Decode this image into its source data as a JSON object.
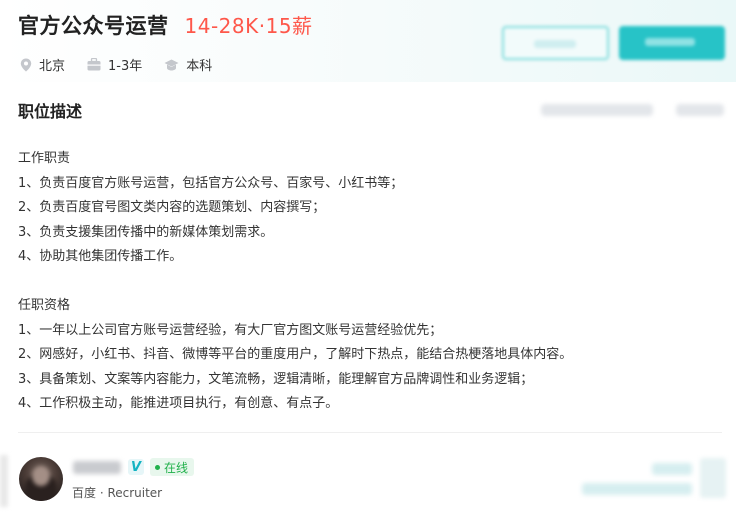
{
  "job": {
    "title": "官方公众号运营",
    "salary": "14-28K·15薪",
    "tags": [
      {
        "icon": "location-icon",
        "text": "北京"
      },
      {
        "icon": "briefcase-icon",
        "text": "1-3年"
      },
      {
        "icon": "graduation-cap-icon",
        "text": "本科"
      }
    ]
  },
  "description": {
    "heading": "职位描述",
    "lines": [
      "工作职责",
      "1、负责百度官方账号运营，包括官方公众号、百家号、小红书等；",
      "2、负责百度官号图文类内容的选题策划、内容撰写；",
      "3、负责支援集团传播中的新媒体策划需求。",
      "4、协助其他集团传播工作。",
      "",
      "任职资格",
      "1、一年以上公司官方账号运营经验，有大厂官方图文账号运营经验优先；",
      "2、网感好，小红书、抖音、微博等平台的重度用户，了解时下热点，能结合热梗落地具体内容。",
      "3、具备策划、文案等内容能力，文笔流畅，逻辑清晰，能理解官方品牌调性和业务逻辑；",
      "4、工作积极主动，能推进项目执行，有创意、有点子。"
    ]
  },
  "recruiter": {
    "verified_badge": "V",
    "status": "在线",
    "company_role": "百度 · Recruiter"
  },
  "colors": {
    "salary": "#fe574a",
    "accent": "#27c3c7",
    "online": "#22b14c"
  }
}
